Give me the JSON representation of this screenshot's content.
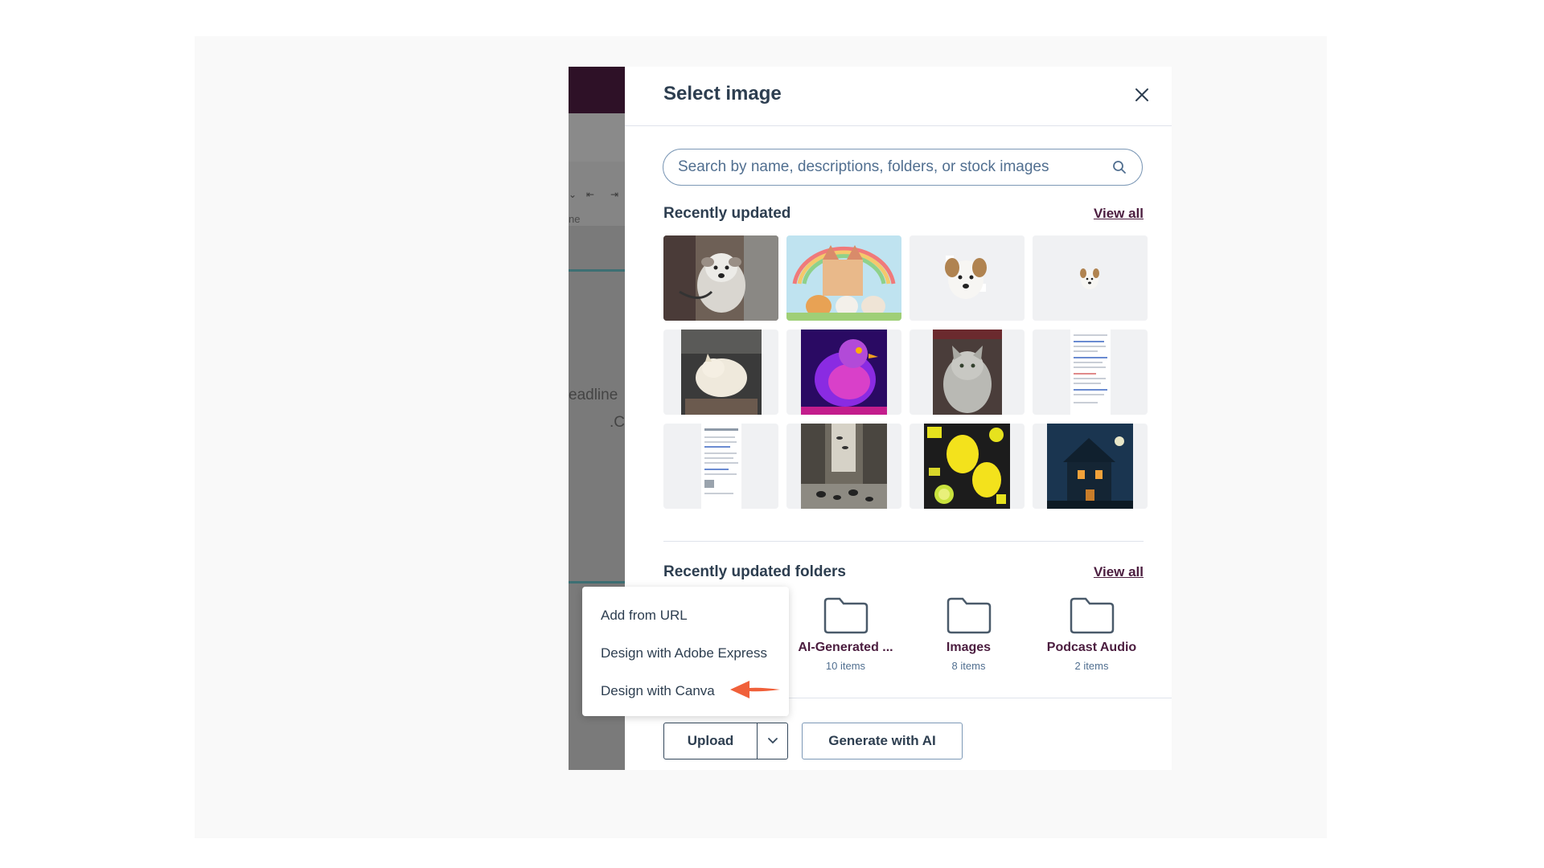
{
  "background_app": {
    "partial_text_1": "eadline",
    "partial_text_2": ".C",
    "partial_toolbar_word": "ne"
  },
  "modal": {
    "title": "Select image",
    "search": {
      "placeholder": "Search by name, descriptions, folders, or stock images",
      "value": ""
    },
    "recent": {
      "title": "Recently updated",
      "view_all": "View all",
      "thumbnails": [
        {
          "name": "dog-on-leash"
        },
        {
          "name": "rainbow-castle-animals"
        },
        {
          "name": "dog-cutout-large"
        },
        {
          "name": "dog-cutout-small"
        },
        {
          "name": "cat-on-chair"
        },
        {
          "name": "neon-pigeon"
        },
        {
          "name": "gray-cat"
        },
        {
          "name": "document-screenshot-1"
        },
        {
          "name": "document-screenshot-2"
        },
        {
          "name": "city-pigeons"
        },
        {
          "name": "lemons-pattern"
        },
        {
          "name": "haunted-house"
        }
      ]
    },
    "folders": {
      "title": "Recently updated folders",
      "view_all": "View all",
      "items": [
        {
          "name": "AI-Generated ...",
          "count": "10 items"
        },
        {
          "name": "Images",
          "count": "8 items"
        },
        {
          "name": "Podcast Audio",
          "count": "2 items"
        }
      ]
    },
    "footer": {
      "upload_label": "Upload",
      "generate_label": "Generate with AI"
    }
  },
  "dropdown": {
    "items": [
      {
        "label": "Add from URL"
      },
      {
        "label": "Design with Adobe Express"
      },
      {
        "label": "Design with Canva"
      }
    ]
  },
  "colors": {
    "accent": "#4b1d3f",
    "annotation_arrow": "#f0603a",
    "topbar": "#2e1127"
  }
}
